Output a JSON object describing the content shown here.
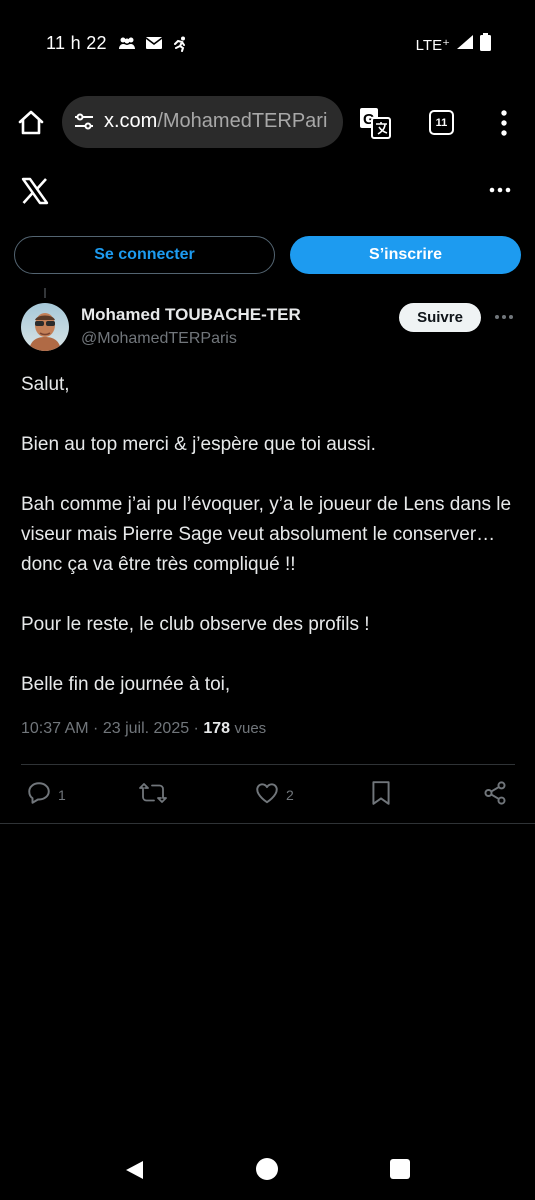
{
  "status_bar": {
    "time": "11 h 22",
    "network": "LTE⁺",
    "icons": [
      "group-icon",
      "mail-icon",
      "running-icon",
      "signal-icon",
      "battery-icon"
    ]
  },
  "browser": {
    "url_domain": "x.com",
    "url_path": "/MohamedTERPari",
    "tab_count": "11",
    "icons": [
      "home-icon",
      "site-settings-icon",
      "translate-icon",
      "tabs-icon",
      "overflow-menu-icon"
    ]
  },
  "header": {
    "logo": "x-logo-icon",
    "more": "more-icon"
  },
  "auth": {
    "login_label": "Se connecter",
    "signup_label": "S’inscrire",
    "login_color": "#1d9bf0",
    "signup_bg": "#1d9bf0"
  },
  "tweet": {
    "author_name": "Mohamed TOUBACHE-TER",
    "author_handle": "@MohamedTERParis",
    "follow_label": "Suivre",
    "paragraphs": [
      "Salut,",
      "Bien au top merci & j’espère que toi aussi.",
      "Bah comme j’ai pu l’évoquer, y’a le joueur de Lens dans le viseur mais Pierre Sage veut absolument le conserver… donc ça va être très compliqué !!",
      "Pour le reste, le club observe des profils !",
      "Belle fin de journée à toi,"
    ],
    "timestamp": "10:37 AM · 23 juil. 2025 · ",
    "views_count": "178",
    "views_label": "vues",
    "actions": {
      "reply_count": "1",
      "retweet_count": "",
      "like_count": "2"
    }
  },
  "colors": {
    "background": "#000000",
    "text_primary": "#e7e9ea",
    "text_secondary": "#71767b",
    "accent": "#1d9bf0",
    "divider": "#2f3336"
  }
}
